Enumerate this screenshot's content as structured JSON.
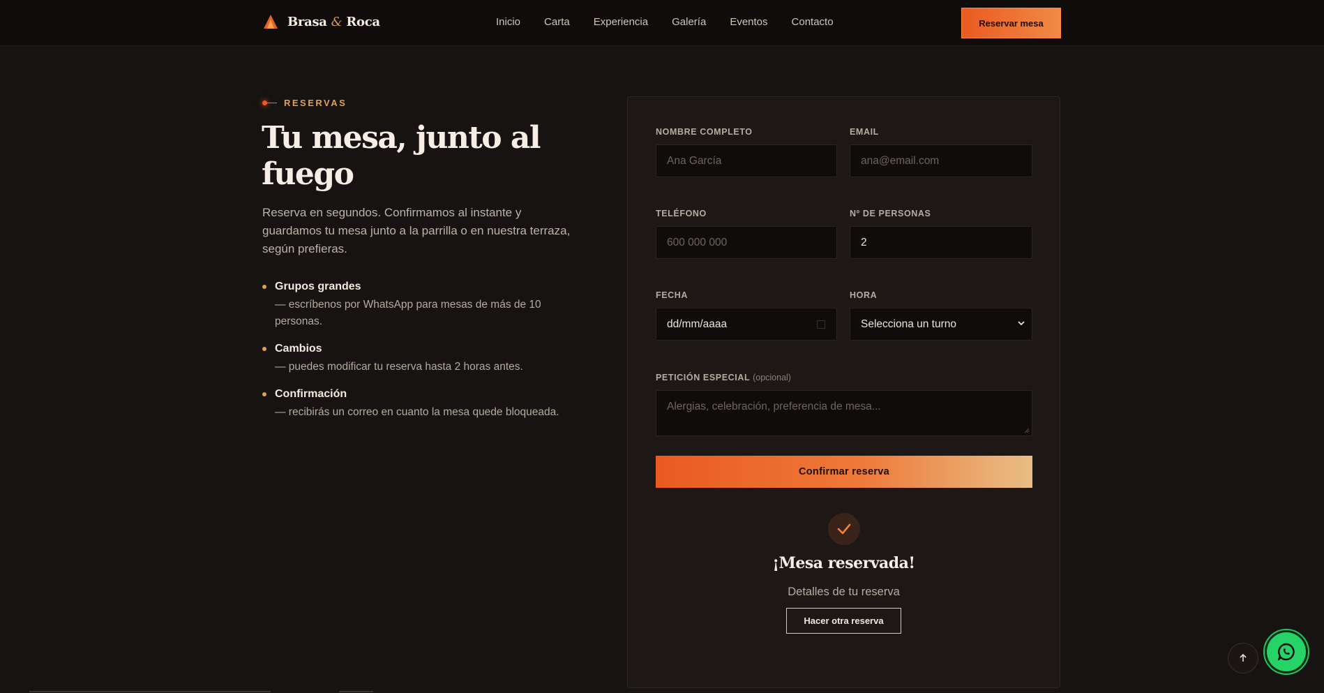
{
  "brand": {
    "name_part1": "Brasa",
    "amp": "&",
    "name_part2": "Roca"
  },
  "nav": {
    "links": [
      "Inicio",
      "Carta",
      "Experiencia",
      "Galería",
      "Eventos",
      "Contacto"
    ],
    "cta": "Reservar mesa"
  },
  "hero": {
    "eyebrow": "RESERVAS",
    "title": "Tu mesa, junto al fuego",
    "description": "Reserva en segundos. Confirmamos al instante y guardamos tu mesa junto a la parrilla o en nuestra terraza, según prefieras."
  },
  "perks": [
    {
      "title": "Grupos grandes",
      "desc": "— escríbenos por WhatsApp para mesas de más de 10 personas."
    },
    {
      "title": "Cambios",
      "desc": "— puedes modificar tu reserva hasta 2 horas antes."
    },
    {
      "title": "Confirmación",
      "desc": "— recibirás un correo en cuanto la mesa quede bloqueada."
    }
  ],
  "form": {
    "name": {
      "label": "NOMBRE COMPLETO",
      "placeholder": "Ana García",
      "value": ""
    },
    "email": {
      "label": "EMAIL",
      "placeholder": "ana@email.com",
      "value": ""
    },
    "phone": {
      "label": "TELÉFONO",
      "placeholder": "600 000 000",
      "value": ""
    },
    "people": {
      "label": "Nº DE PERSONAS",
      "value": "2"
    },
    "date": {
      "label": "FECHA",
      "value": "dd/mm/aaaa"
    },
    "time": {
      "label": "HORA",
      "value": "Selecciona un turno"
    },
    "special": {
      "label": "PETICIÓN ESPECIAL",
      "optional": "(opcional)",
      "placeholder": "Alergias, celebración, preferencia de mesa..."
    },
    "submit": "Confirmar reserva"
  },
  "success": {
    "title": "¡Mesa reservada!",
    "subtitle": "Detalles de tu reserva",
    "again": "Hacer otra reserva"
  },
  "colors": {
    "accent": "#ea5a21",
    "gold": "#e3a050",
    "bg": "#171312",
    "whatsapp": "#25d366"
  },
  "icons": [
    "flame-logo-icon",
    "chevron-down-icon",
    "calendar-icon",
    "check-icon",
    "arrow-up-icon",
    "whatsapp-icon"
  ]
}
